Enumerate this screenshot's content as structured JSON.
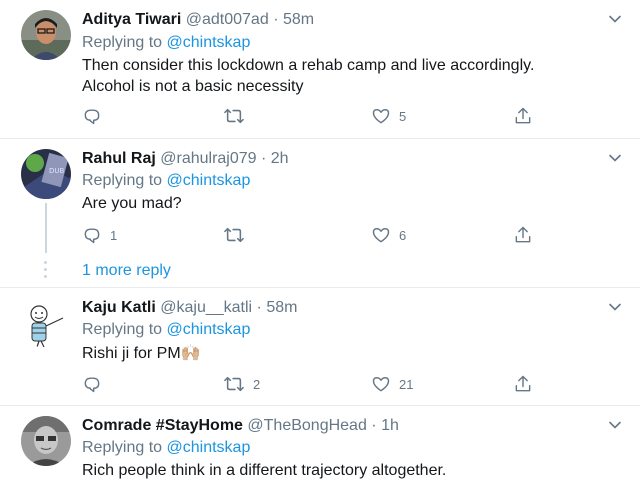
{
  "tweets": [
    {
      "name": "Aditya Tiwari",
      "handle": "@adt007ad",
      "separator": "·",
      "time": "58m",
      "replying_label": "Replying to",
      "replying_to": "@chintskap",
      "text_line1": "Then consider this lockdown a rehab camp and live accordingly.",
      "text_line2": "Alcohol is not a basic necessity",
      "replies": "",
      "retweets": "",
      "likes": "5"
    },
    {
      "name": "Rahul Raj",
      "handle": "@rahulraj079",
      "separator": "·",
      "time": "2h",
      "replying_label": "Replying to",
      "replying_to": "@chintskap",
      "text_line1": "Are you mad?",
      "replies": "1",
      "retweets": "",
      "likes": "6",
      "more_reply": "1 more reply"
    },
    {
      "name": "Kaju Katli",
      "handle": "@kaju__katli",
      "separator": "·",
      "time": "58m",
      "replying_label": "Replying to",
      "replying_to": "@chintskap",
      "text_line1": "Rishi ji for PM",
      "emoji": "🙌🏼",
      "replies": "",
      "retweets": "2",
      "likes": "21"
    },
    {
      "name": "Comrade #StayHome",
      "handle": "@TheBongHead",
      "separator": "·",
      "time": "1h",
      "replying_label": "Replying to",
      "replying_to": "@chintskap",
      "text_line1": "Rich people think in a different trajectory altogether."
    }
  ],
  "colors": {
    "accent": "#1b95e0",
    "muted": "#657786",
    "border": "#e6ecf0"
  },
  "icons": [
    "chevron-down-icon",
    "reply-icon",
    "retweet-icon",
    "heart-icon",
    "share-icon"
  ]
}
